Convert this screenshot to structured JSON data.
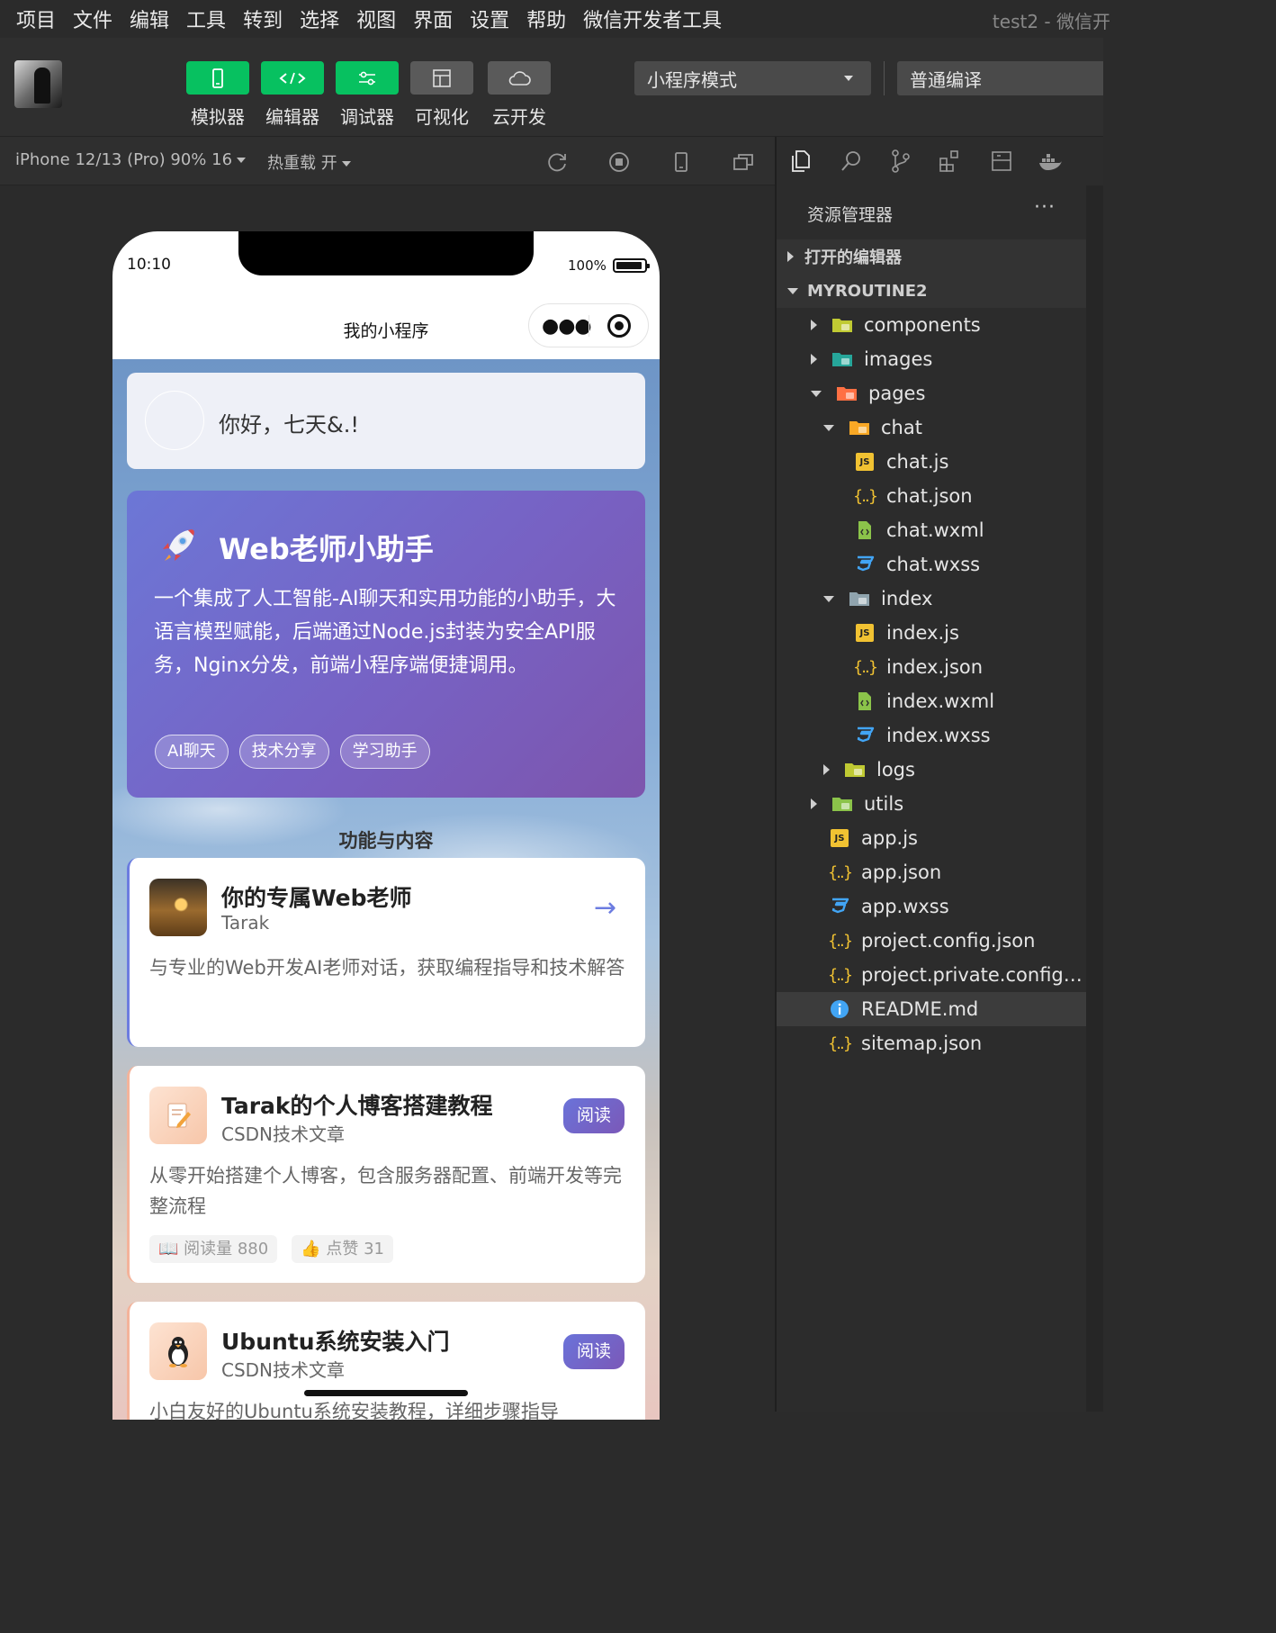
{
  "menu": [
    "项目",
    "文件",
    "编辑",
    "工具",
    "转到",
    "选择",
    "视图",
    "界面",
    "设置",
    "帮助",
    "微信开发者工具"
  ],
  "window_title": "test2 - 微信开",
  "toolbar": {
    "simulator": "模拟器",
    "editor": "编辑器",
    "debugger": "调试器",
    "visual": "可视化",
    "cloud": "云开发",
    "mode": "小程序模式",
    "compile": "普通编译"
  },
  "simbar": {
    "device": "iPhone 12/13 (Pro) 90% 16",
    "hot_reload": "热重载 开"
  },
  "phone": {
    "time": "10:10",
    "battery": "100%",
    "nav_title": "我的小程序",
    "greeting": "你好，七天&.!",
    "hero": {
      "title": "Web老师小助手",
      "desc": "一个集成了人工智能-AI聊天和实用功能的小助手，大语言模型赋能，后端通过Node.js封装为安全API服务，Nginx分发，前端小程序端便捷调用。",
      "tags": [
        "AI聊天",
        "技术分享",
        "学习助手"
      ]
    },
    "section_title": "功能与内容",
    "cards": [
      {
        "title": "你的专属Web老师",
        "sub": "Tarak",
        "desc": "与专业的Web开发AI老师对话，获取编程指导和技术解答",
        "arrow": "→"
      },
      {
        "title": "Tarak的个人博客搭建教程",
        "sub": "CSDN技术文章",
        "desc": "从零开始搭建个人博客，包含服务器配置、前端开发等完整流程",
        "button": "阅读",
        "reads": "📖 阅读量 880",
        "likes": "👍 点赞 31"
      },
      {
        "title": "Ubuntu系统安装入门",
        "sub": "CSDN技术文章",
        "desc": "小白友好的Ubuntu系统安装教程，详细步骤指导",
        "button": "阅读"
      }
    ]
  },
  "explorer": {
    "header": "资源管理器",
    "more": "···",
    "open_editors": "打开的编辑器",
    "project": "MYROUTINE2",
    "tree": [
      {
        "name": "components",
        "type": "folder-components",
        "depth": 1,
        "state": "collapsed"
      },
      {
        "name": "images",
        "type": "folder-images",
        "depth": 1,
        "state": "collapsed"
      },
      {
        "name": "pages",
        "type": "folder-pages",
        "depth": 1,
        "state": "expanded"
      },
      {
        "name": "chat",
        "type": "folder-chat",
        "depth": 2,
        "state": "expanded"
      },
      {
        "name": "chat.js",
        "type": "js",
        "depth": 3
      },
      {
        "name": "chat.json",
        "type": "json",
        "depth": 3
      },
      {
        "name": "chat.wxml",
        "type": "wxml",
        "depth": 3
      },
      {
        "name": "chat.wxss",
        "type": "wxss",
        "depth": 3
      },
      {
        "name": "index",
        "type": "folder-index",
        "depth": 2,
        "state": "expanded"
      },
      {
        "name": "index.js",
        "type": "js",
        "depth": 3
      },
      {
        "name": "index.json",
        "type": "json",
        "depth": 3
      },
      {
        "name": "index.wxml",
        "type": "wxml",
        "depth": 3
      },
      {
        "name": "index.wxss",
        "type": "wxss",
        "depth": 3
      },
      {
        "name": "logs",
        "type": "folder-logs",
        "depth": 2,
        "state": "collapsed"
      },
      {
        "name": "utils",
        "type": "folder-utils",
        "depth": 1,
        "state": "collapsed"
      },
      {
        "name": "app.js",
        "type": "js",
        "depth": 1
      },
      {
        "name": "app.json",
        "type": "json",
        "depth": 1
      },
      {
        "name": "app.wxss",
        "type": "wxss",
        "depth": 1
      },
      {
        "name": "project.config.json",
        "type": "json",
        "depth": 1
      },
      {
        "name": "project.private.config.json",
        "type": "json",
        "depth": 1
      },
      {
        "name": "README.md",
        "type": "info",
        "depth": 1,
        "selected": true
      },
      {
        "name": "sitemap.json",
        "type": "json",
        "depth": 1
      }
    ]
  },
  "colors": {
    "wechat_green": "#07c160",
    "hero_start": "#6c77d6",
    "hero_end": "#7d55ad",
    "accent_blue": "#6c7ce0",
    "js_yellow": "#f1c232"
  }
}
